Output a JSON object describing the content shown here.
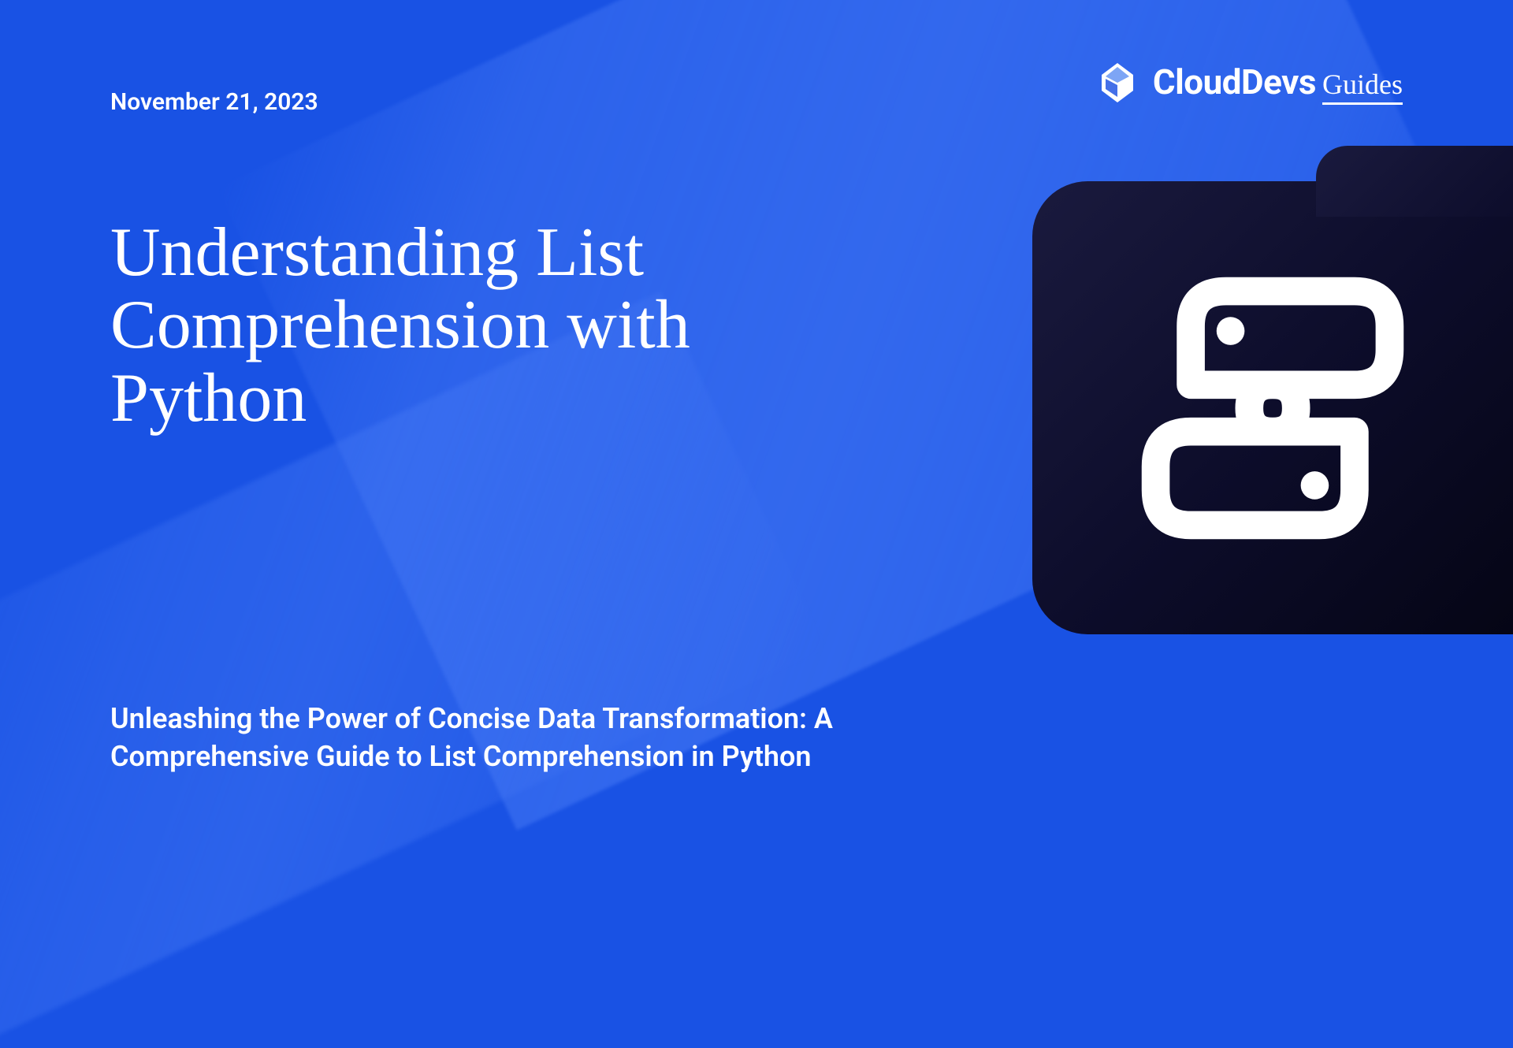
{
  "date": "November 21, 2023",
  "logo": {
    "brand": "CloudDevs",
    "suffix": "Guides"
  },
  "title": "Understanding List Comprehension with Python",
  "subtitle": "Unleashing the Power of Concise Data Transformation: A Comprehensive Guide to List Comprehension in Python"
}
